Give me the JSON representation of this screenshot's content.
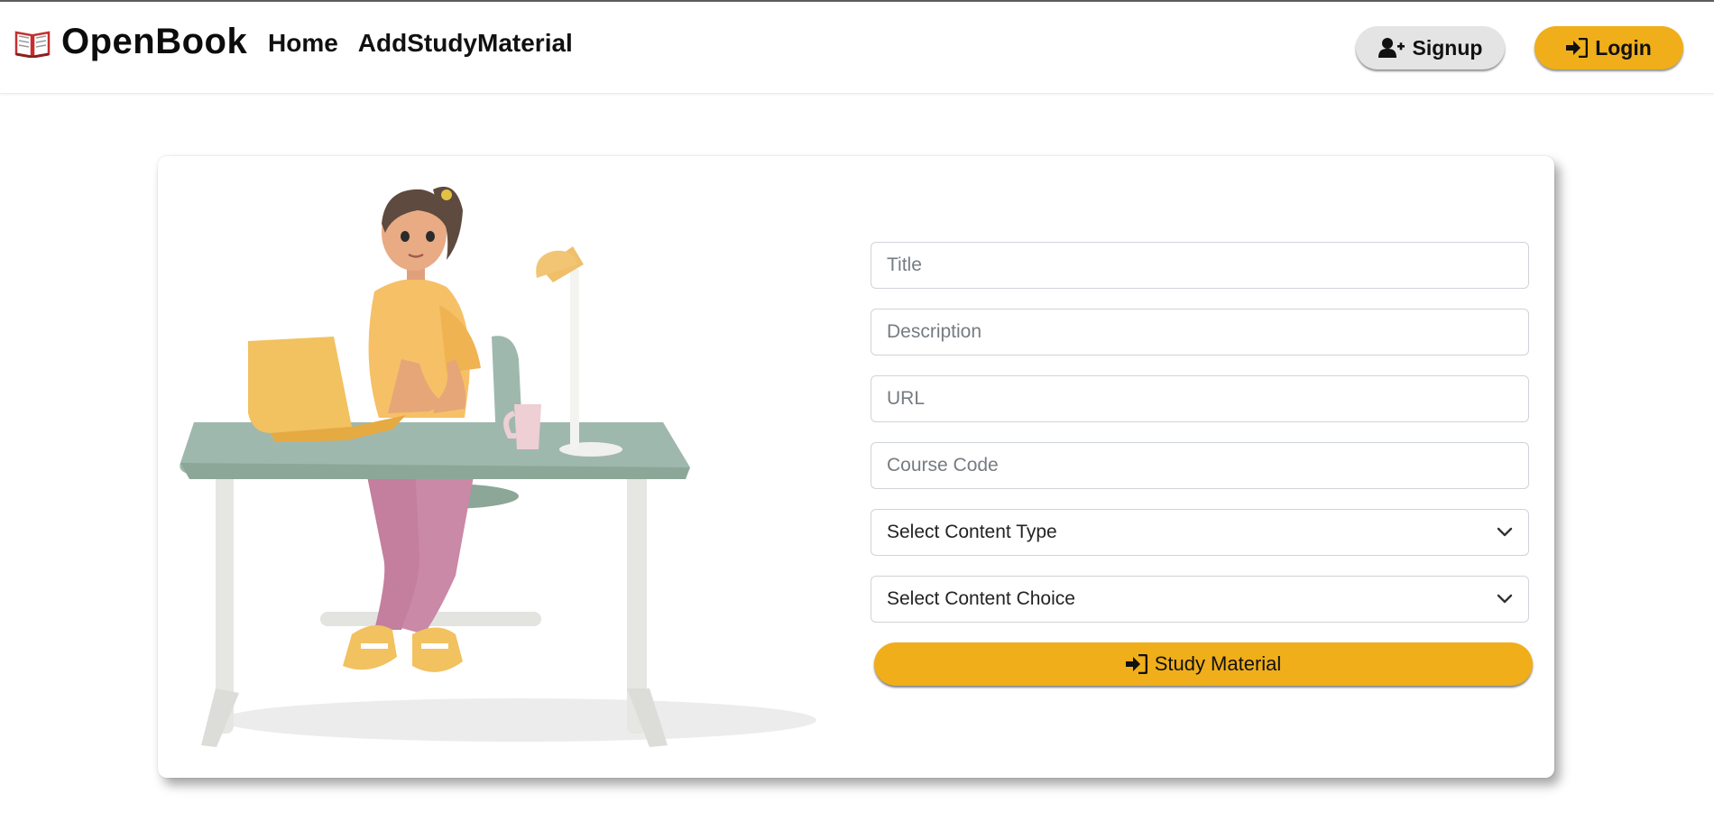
{
  "navbar": {
    "brand": "OpenBook",
    "brand_icon": "open-book-icon",
    "links": [
      {
        "label": "Home"
      },
      {
        "label": "AddStudyMaterial"
      }
    ],
    "signup_label": "Signup",
    "login_label": "Login"
  },
  "form": {
    "title_placeholder": "Title",
    "description_placeholder": "Description",
    "url_placeholder": "URL",
    "course_code_placeholder": "Course Code",
    "content_type_selected": "Select Content Type",
    "content_choice_selected": "Select Content Choice",
    "submit_label": "Study Material"
  },
  "colors": {
    "accent": "#f0ae1b",
    "signup_bg": "#e4e4e4",
    "desk": "#9fb8ad"
  },
  "icons": {
    "signup": "user-plus-icon",
    "login": "sign-in-icon",
    "submit": "sign-in-icon",
    "select": "chevron-down-icon"
  }
}
